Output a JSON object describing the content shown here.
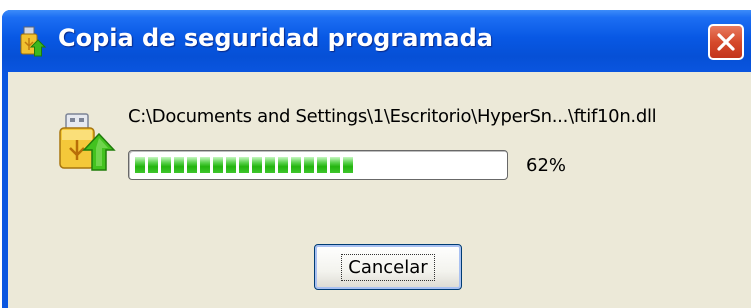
{
  "window": {
    "title": "Copia de seguridad programada",
    "close_icon": "close-icon"
  },
  "dialog": {
    "file_path": "C:\\Documents and Settings\\1\\Escritorio\\HyperSn...\\ftif10n.dll",
    "progress": 0.62,
    "progress_label": "62%",
    "cancel_label": "Cancelar",
    "app_icon": "usb-backup-upload-icon"
  },
  "colors": {
    "titlebar": "#0650d6",
    "close_button": "#d64a2c",
    "progress_fill": "#24b50f",
    "client_background": "#ece9d8"
  }
}
